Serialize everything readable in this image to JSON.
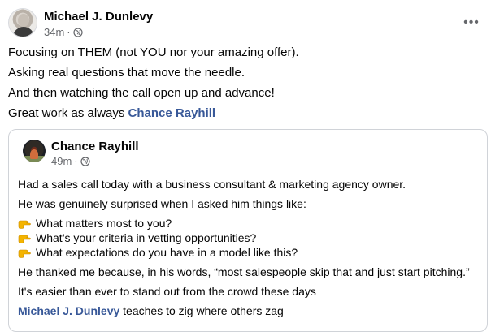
{
  "post": {
    "author": "Michael J. Dunlevy",
    "time": "34m",
    "separator": "·",
    "more_label": "•••",
    "paragraphs": [
      "Focusing on THEM (not YOU nor your amazing offer).",
      "Asking real questions that move the needle.",
      "And then watching the call open up and advance!"
    ],
    "closing_text": "Great work as always ",
    "closing_mention": "Chance Rayhill"
  },
  "shared": {
    "author": "Chance Rayhill",
    "time": "49m",
    "separator": "·",
    "line1": "Had a sales call today with a business consultant & marketing agency owner.",
    "line2": "He was genuinely surprised when I asked him things like:",
    "bullets": [
      "What matters most to you?",
      "What’s your criteria in vetting opportunities?",
      "What expectations do you have in a model like this?"
    ],
    "line3": "He thanked me because, in his words, “most salespeople skip that and just start pitching.”",
    "line4": "It's easier than ever to stand out from the crowd these days",
    "closing_mention": "Michael J. Dunlevy",
    "closing_text": " teaches to zig where others zag"
  },
  "icons": {
    "globe": "globe-icon",
    "more": "more-options-icon",
    "pointing": "pointing-right-icon"
  },
  "colors": {
    "mention": "#385898",
    "muted": "#65676b",
    "pointing_hand": "#f4b400"
  }
}
